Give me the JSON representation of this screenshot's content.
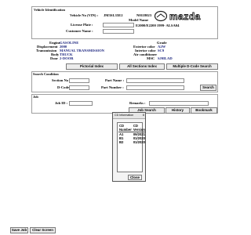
{
  "vehicle": {
    "section_title": "Vehicle Identification",
    "vin_label": "Vehicle No (VIN) :",
    "vin_value": "JM3SL35E2",
    "vin_suffix": "N0118023",
    "model_name_label": "Model Name",
    "model_name_value": "E2000/E2200 1999- ALSA04",
    "license_label": "License Plate :",
    "customer_label": "Customer Name :",
    "brand_logo": "mazda"
  },
  "specs": {
    "engine_label": "Engine",
    "engine_value": "GASOLINE",
    "grade_label": "Grade",
    "displacement_label": "Displacement",
    "displacement_value": "2000",
    "exterior_label": "Exterior color",
    "exterior_value": "A2W",
    "transmission_label": "Transmission",
    "transmission_value": "MANUAL TRANSMISSION",
    "interior_label": "Interior color",
    "interior_value": "SC9",
    "body_label": "Body",
    "body_value": "TRUCK",
    "aircon_label": "Air conditioner",
    "door_label": "Door",
    "door_value": "2-DOOR",
    "msc_label": "MSC",
    "msc_value": "SJ0ILAD"
  },
  "nav_buttons": {
    "pictorial_index": "Pictorial Index",
    "all_sections_index": "All Sections Index",
    "multiple_dcode_search": "Multiple D-Code Search"
  },
  "search": {
    "section_title": "Search Condition",
    "section_no_label": "Section No :",
    "part_name_label": "Part Name :",
    "dcode_label": "D-Code :",
    "part_number_label": "Part Number :",
    "search_button": "Search"
  },
  "job": {
    "section_title": "Job",
    "job_id_label": "Job ID :",
    "remarks_label": "Remarks :",
    "job_search_button": "Job Search",
    "history_button": "History",
    "bookmark_button": "Bookmark"
  },
  "cd_dialog": {
    "title": "CD Information",
    "close_x": "x",
    "columns": [
      "CD Number",
      "CD Version"
    ],
    "rows": [
      [
        "A1",
        "09/2021"
      ],
      [
        "B1",
        "01/2020"
      ],
      [
        "B2",
        "01/2020"
      ]
    ],
    "close_button": "Close"
  },
  "bottom": {
    "save_job": "Save Job",
    "clear_screen": "Clear Screen"
  }
}
